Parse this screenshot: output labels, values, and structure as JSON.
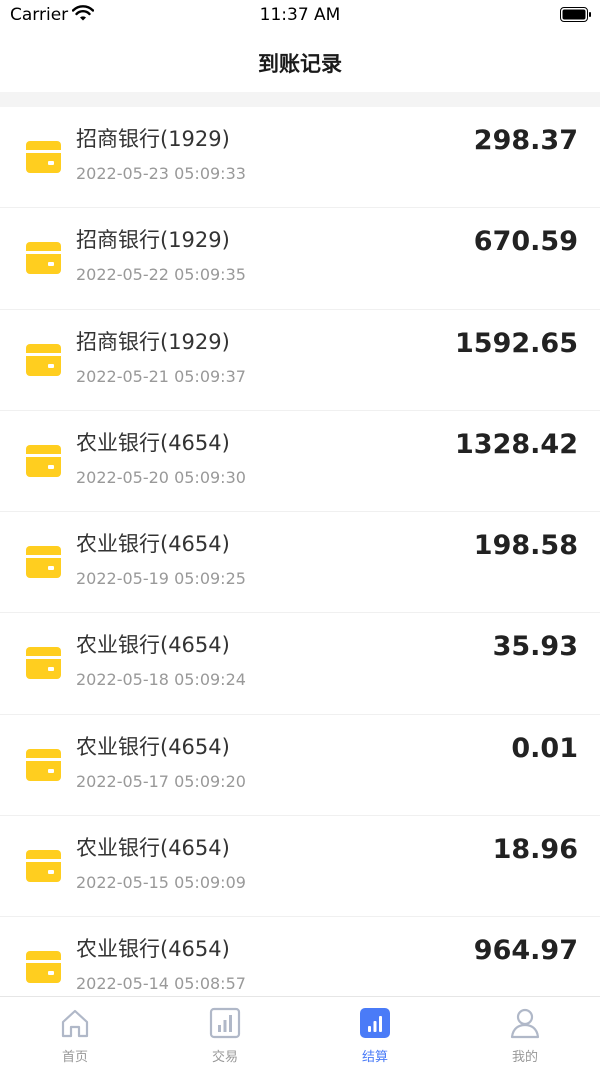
{
  "status_bar": {
    "carrier": "Carrier",
    "time": "11:37 AM"
  },
  "header": {
    "title": "到账记录"
  },
  "colors": {
    "accent": "#4a7bf7",
    "card_icon": "#ffce1f",
    "inactive": "#b0b8c8"
  },
  "records": [
    {
      "bank": "招商银行(1929)",
      "time": "2022-05-23 05:09:33",
      "amount": "298.37"
    },
    {
      "bank": "招商银行(1929)",
      "time": "2022-05-22 05:09:35",
      "amount": "670.59"
    },
    {
      "bank": "招商银行(1929)",
      "time": "2022-05-21 05:09:37",
      "amount": "1592.65"
    },
    {
      "bank": "农业银行(4654)",
      "time": "2022-05-20 05:09:30",
      "amount": "1328.42"
    },
    {
      "bank": "农业银行(4654)",
      "time": "2022-05-19 05:09:25",
      "amount": "198.58"
    },
    {
      "bank": "农业银行(4654)",
      "time": "2022-05-18 05:09:24",
      "amount": "35.93"
    },
    {
      "bank": "农业银行(4654)",
      "time": "2022-05-17 05:09:20",
      "amount": "0.01"
    },
    {
      "bank": "农业银行(4654)",
      "time": "2022-05-15 05:09:09",
      "amount": "18.96"
    },
    {
      "bank": "农业银行(4654)",
      "time": "2022-05-14 05:08:57",
      "amount": "964.97"
    }
  ],
  "tabs": [
    {
      "label": "首页",
      "icon": "home-icon",
      "active": false
    },
    {
      "label": "交易",
      "icon": "trade-chart-icon",
      "active": false
    },
    {
      "label": "结算",
      "icon": "settlement-chart-icon",
      "active": true
    },
    {
      "label": "我的",
      "icon": "profile-icon",
      "active": false
    }
  ]
}
